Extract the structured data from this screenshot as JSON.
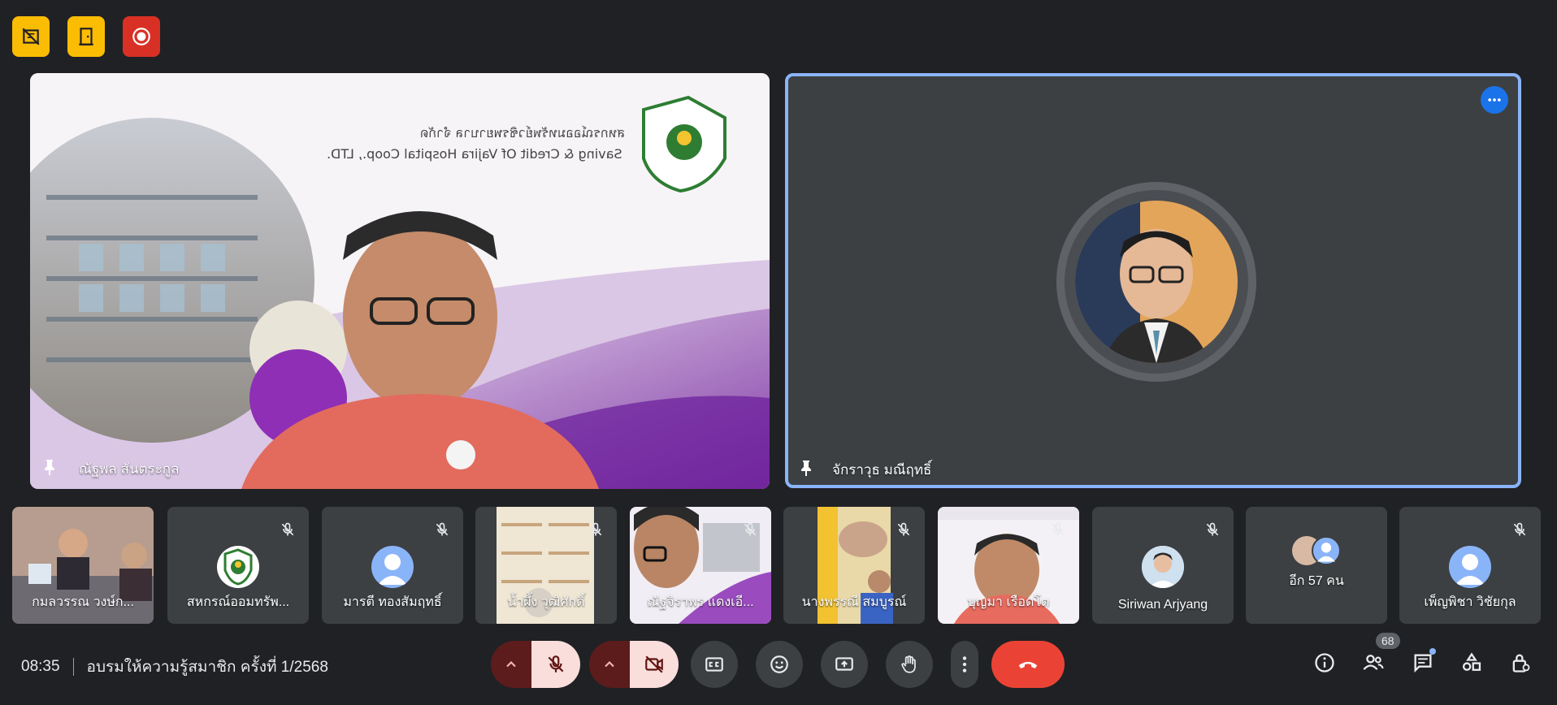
{
  "badges": [
    {
      "icon": "no-ads-icon",
      "color": "#fbbc04"
    },
    {
      "icon": "door-icon",
      "color": "#fbbc04"
    },
    {
      "icon": "record-icon",
      "color": "#d93025"
    }
  ],
  "presenter": {
    "name": "ณัฐพล สันตระกูล",
    "slide_org_th": "สหกรณ์ออมทรัพย์วชิรพยาบาล จำกัด",
    "slide_org_en": "Saving & Credit Of Vajira Hospital Coop., LTD."
  },
  "speaker": {
    "name": "จักราวุธ มณีฤทธิ์"
  },
  "thumbnails": [
    {
      "name": "กมลวรรณ วงษ์ก...",
      "type": "video",
      "muted": false
    },
    {
      "name": "สหกรณ์ออมทรัพ...",
      "type": "logo",
      "muted": true
    },
    {
      "name": "มารตี ทองสัมฤทธิ์",
      "type": "avatar",
      "muted": true
    },
    {
      "name": "น้ำผึ้ง วุฒิศักดิ์",
      "type": "video",
      "muted": true
    },
    {
      "name": "ณัฐจิราพร แดงเอี...",
      "type": "video",
      "muted": true
    },
    {
      "name": "นางพรรณี สมบูรณ์",
      "type": "video",
      "muted": true
    },
    {
      "name": "บุญมา เรือดโต",
      "type": "video",
      "muted": true
    },
    {
      "name": "Siriwan Arjyang",
      "type": "photo",
      "muted": true
    },
    {
      "name": "อีก 57 คน",
      "type": "group",
      "muted": false
    },
    {
      "name": "เพ็ญพิชา วิชัยกุล",
      "type": "avatar",
      "muted": true
    }
  ],
  "meeting": {
    "time": "08:35",
    "title": "อบรมให้ความรู้สมาชิก ครั้งที่ 1/2568",
    "participant_count": "68"
  },
  "controls": [
    "mic-off-icon",
    "camera-off-icon",
    "captions-icon",
    "emoji-icon",
    "present-icon",
    "raise-hand-icon",
    "more-vert-icon",
    "end-call-icon"
  ],
  "right_controls": [
    "info-icon",
    "people-icon",
    "chat-icon",
    "activities-icon",
    "host-controls-icon"
  ]
}
